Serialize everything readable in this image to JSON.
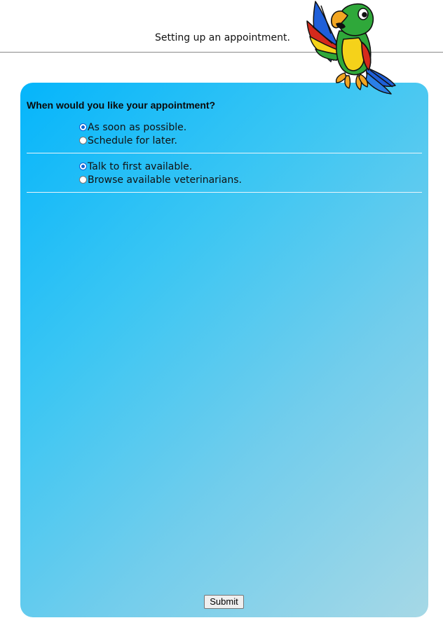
{
  "header": {
    "title": "Setting up an appointment."
  },
  "mascot": {
    "icon": "parrot-mascot-icon",
    "colors": {
      "body_green": "#2fa83a",
      "chest_yellow": "#f5d21a",
      "wing_blue": "#1f5fd9",
      "accent_red": "#d62a1c",
      "beak_orange": "#f2a623"
    }
  },
  "form": {
    "question": "When would you like your appointment?",
    "timing_options": [
      {
        "label": "As soon as possible.",
        "checked": true
      },
      {
        "label": "Schedule for later.",
        "checked": false
      }
    ],
    "vet_options": [
      {
        "label": "Talk to first available.",
        "checked": true
      },
      {
        "label": "Browse available veterinarians.",
        "checked": false
      }
    ],
    "submit_label": "Submit"
  },
  "colors": {
    "panel_gradient_start": "#05b5fb",
    "panel_gradient_end": "#a6d8e6",
    "radio_checked": "#0b61d6"
  }
}
